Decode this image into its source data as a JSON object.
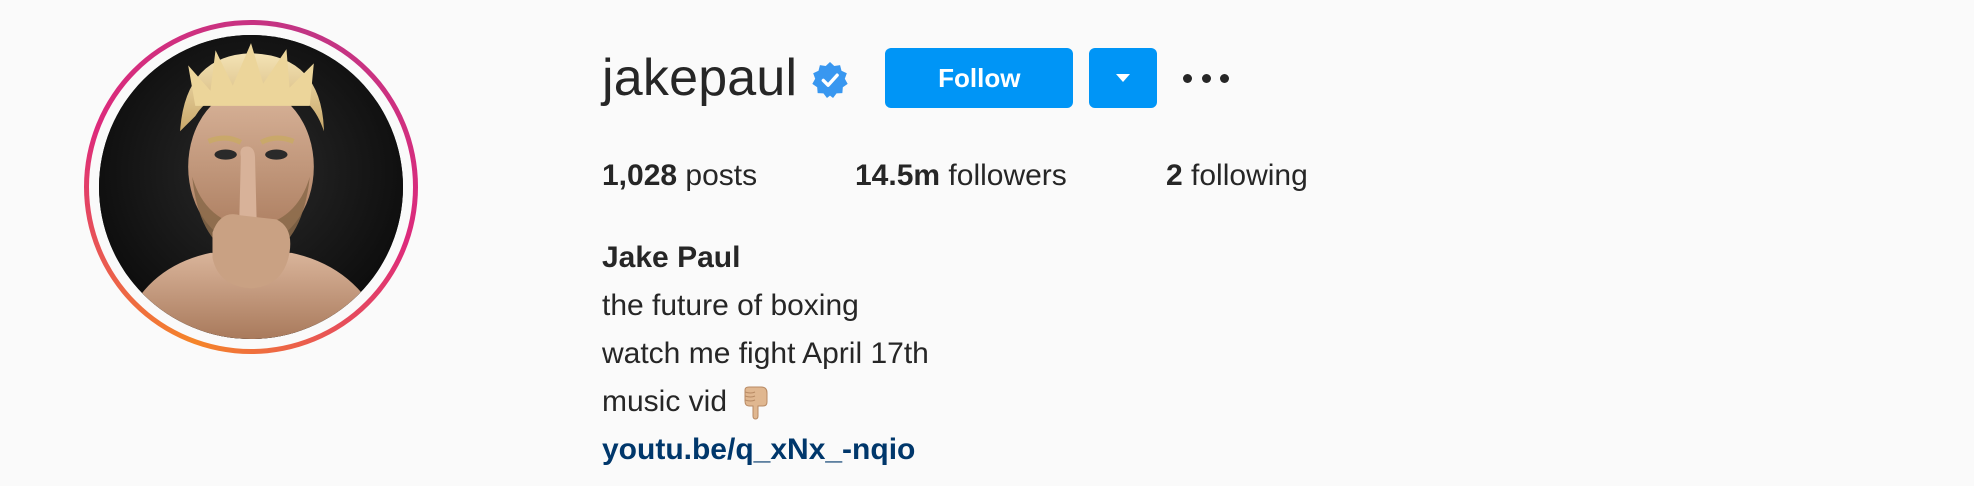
{
  "profile": {
    "username": "jakepaul",
    "verified": true,
    "full_name": "Jake Paul",
    "avatar_icon": "profile-photo"
  },
  "actions": {
    "follow_label": "Follow",
    "dropdown_icon": "caret-down-icon",
    "more_icon": "ellipsis-icon"
  },
  "stats": {
    "posts_count": "1,028",
    "posts_label": "posts",
    "followers_count": "14.5m",
    "followers_label": "followers",
    "following_count": "2",
    "following_label": "following"
  },
  "bio": {
    "lines": [
      "the future of boxing",
      "watch me fight April 17th",
      "music vid"
    ],
    "emoji_icon": "pointing-down-icon",
    "link": "youtu.be/q_xNx_-nqio"
  },
  "colors": {
    "accent": "#0095f6",
    "link": "#00376b",
    "text": "#262626",
    "background": "#fafafa"
  }
}
